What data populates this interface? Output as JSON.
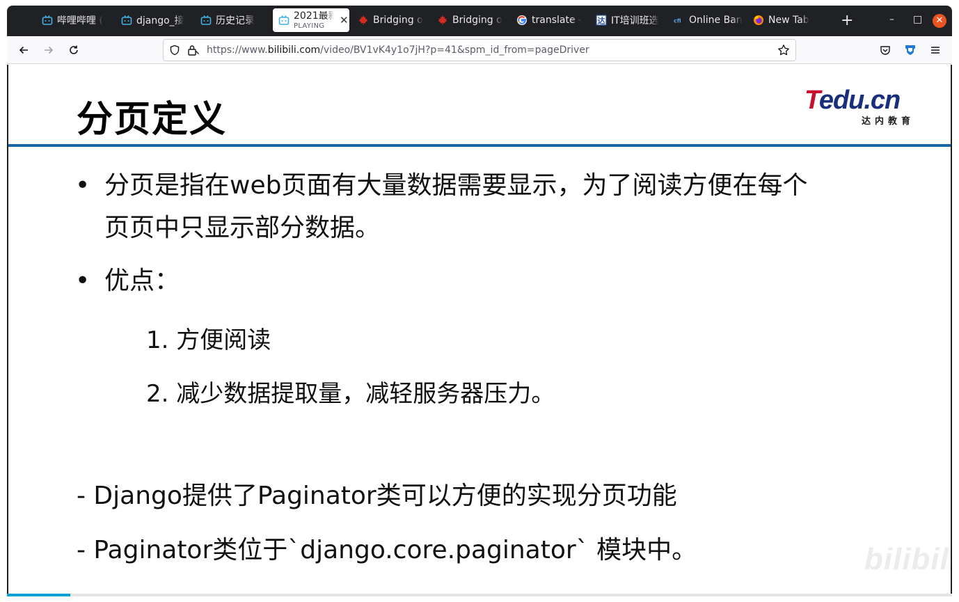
{
  "tabs": [
    {
      "label": "哔哩哔哩 (",
      "icon": "bilibili-icon"
    },
    {
      "label": "django_接",
      "icon": "bilibili-icon"
    },
    {
      "label": "历史记录",
      "icon": "bilibili-icon"
    },
    {
      "label": "2021最新",
      "sub": "PLAYING",
      "icon": "bilibili-icon",
      "active": true
    },
    {
      "label": "Bridging o",
      "icon": "maple-leaf-icon"
    },
    {
      "label": "Bridging o",
      "icon": "maple-leaf-icon"
    },
    {
      "label": "translate -",
      "icon": "google-icon"
    },
    {
      "label": "IT培训班选",
      "icon": "site-icon"
    },
    {
      "label": "Online Ban",
      "icon": "cfi-icon"
    },
    {
      "label": "New Tab",
      "icon": "firefox-icon"
    }
  ],
  "address": {
    "prefix": "https://www.",
    "host": "bilibili.com",
    "path": "/video/BV1vK4y1o7jH?p=41&spm_id_from=pageDriver"
  },
  "slide": {
    "title": "分页定义",
    "logo_main": "Tedu.cn",
    "logo_sub": "达内教育",
    "bullet1_line1": "分页是指在web页面有大量数据需要显示，为了阅读方便在每个",
    "bullet1_line2": "页页中只显示部分数据。",
    "bullet2": "优点：",
    "item1": "1. 方便阅读",
    "item2": "2. 减少数据提取量，减轻服务器压力。",
    "note1": "- Django提供了Paginator类可以方便的实现分页功能",
    "note2": "- Paginator类位于`django.core.paginator` 模块中。",
    "watermark": "bilibili"
  },
  "playback": {
    "progress": 0.067
  },
  "colors": {
    "accent": "#1766a8",
    "bilibili_blue": "#00a1d6",
    "close": "#e95420"
  }
}
